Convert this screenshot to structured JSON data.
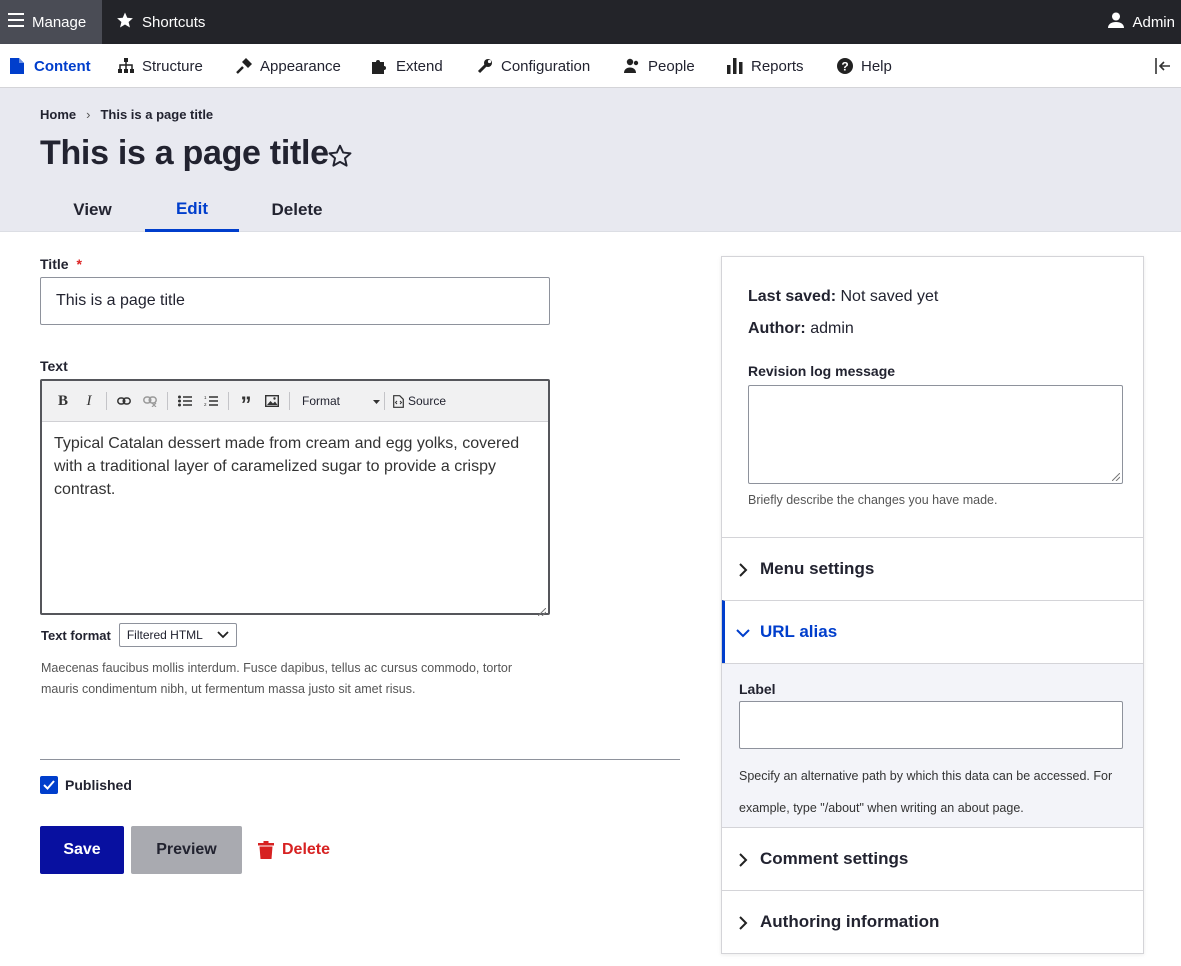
{
  "toolbar": {
    "manage_label": "Manage",
    "shortcuts_label": "Shortcuts",
    "admin_label": "Admin"
  },
  "admin_nav": {
    "items": [
      {
        "label": "Content",
        "icon": "document-icon"
      },
      {
        "label": "Structure",
        "icon": "sitemap-icon"
      },
      {
        "label": "Appearance",
        "icon": "brush-icon"
      },
      {
        "label": "Extend",
        "icon": "puzzle-icon"
      },
      {
        "label": "Configuration",
        "icon": "wrench-icon"
      },
      {
        "label": "People",
        "icon": "people-icon"
      },
      {
        "label": "Reports",
        "icon": "bar-chart-icon"
      },
      {
        "label": "Help",
        "icon": "help-icon"
      }
    ]
  },
  "breadcrumb": {
    "home": "Home",
    "separator": "›",
    "current": "This is a page title"
  },
  "page": {
    "title": "This is a page title"
  },
  "tabs": {
    "view": "View",
    "edit": "Edit",
    "delete": "Delete"
  },
  "form": {
    "title_label": "Title",
    "title_required": "*",
    "title_value": "This is a page title",
    "text_label": "Text",
    "editor": {
      "format_label": "Format",
      "source_label": "Source",
      "body": "Typical Catalan dessert made from cream and egg yolks, covered with a traditional layer of caramelized sugar to provide a crispy contrast."
    },
    "text_format_label": "Text format",
    "text_format_value": "Filtered HTML",
    "text_format_desc": "Maecenas faucibus mollis interdum. Fusce dapibus, tellus ac cursus commodo, tortor mauris condimentum nibh, ut fermentum massa justo sit amet risus.",
    "published_label": "Published",
    "published_checked": true,
    "save_label": "Save",
    "preview_label": "Preview",
    "delete_label": "Delete"
  },
  "sidebar": {
    "last_saved_label": "Last saved:",
    "last_saved_value": "Not saved yet",
    "author_label": "Author:",
    "author_value": "admin",
    "revision_label": "Revision log message",
    "revision_desc": "Briefly describe the changes you have made.",
    "menu_settings": "Menu settings",
    "url_alias": "URL alias",
    "alias_label": "Label",
    "alias_desc": "Specify an alternative path by which this data can be accessed. For example, type \"/about\" when writing an about page.",
    "comment_settings": "Comment settings",
    "authoring_information": "Authoring information"
  },
  "colors": {
    "accent": "#003ecc",
    "danger": "#d72222",
    "toolbar_bg": "#232429"
  }
}
